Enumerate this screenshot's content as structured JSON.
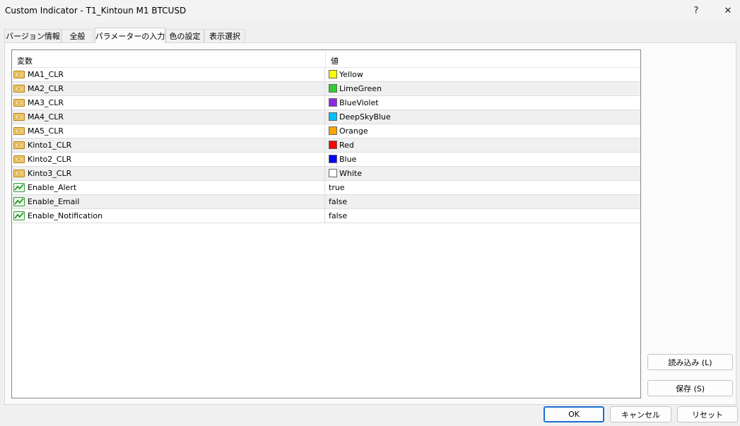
{
  "window": {
    "title": "Custom Indicator - T1_Kintoun M1 BTCUSD",
    "help_label": "?",
    "close_label": "✕"
  },
  "tabs": [
    {
      "label": "バージョン情報"
    },
    {
      "label": "全般"
    },
    {
      "label": "パラメーターの入力",
      "active": true
    },
    {
      "label": "色の設定"
    },
    {
      "label": "表示選択"
    }
  ],
  "grid": {
    "col_variable": "変数",
    "col_value": "値",
    "rows": [
      {
        "name": "MA1_CLR",
        "value": "Yellow",
        "kind": "color",
        "color": "#ffff00",
        "icon": "color-param-icon"
      },
      {
        "name": "MA2_CLR",
        "value": "LimeGreen",
        "kind": "color",
        "color": "#32cd32",
        "icon": "color-param-icon"
      },
      {
        "name": "MA3_CLR",
        "value": "BlueViolet",
        "kind": "color",
        "color": "#8a2be2",
        "icon": "color-param-icon"
      },
      {
        "name": "MA4_CLR",
        "value": "DeepSkyBlue",
        "kind": "color",
        "color": "#00bfff",
        "icon": "color-param-icon"
      },
      {
        "name": "MA5_CLR",
        "value": "Orange",
        "kind": "color",
        "color": "#ffa500",
        "icon": "color-param-icon"
      },
      {
        "name": "Kinto1_CLR",
        "value": "Red",
        "kind": "color",
        "color": "#ff0000",
        "icon": "color-param-icon"
      },
      {
        "name": "Kinto2_CLR",
        "value": "Blue",
        "kind": "color",
        "color": "#0000ff",
        "icon": "color-param-icon"
      },
      {
        "name": "Kinto3_CLR",
        "value": "White",
        "kind": "color",
        "color": "#ffffff",
        "icon": "color-param-icon"
      },
      {
        "name": "Enable_Alert",
        "value": "true",
        "kind": "bool",
        "icon": "bool-param-icon"
      },
      {
        "name": "Enable_Email",
        "value": "false",
        "kind": "bool",
        "icon": "bool-param-icon"
      },
      {
        "name": "Enable_Notification",
        "value": "false",
        "kind": "bool",
        "icon": "bool-param-icon"
      }
    ]
  },
  "side_buttons": {
    "load_label": "読み込み (L)",
    "save_label": "保存 (S)"
  },
  "footer_buttons": {
    "ok_label": "OK",
    "cancel_label": "キャンセル",
    "reset_label": "リセット"
  }
}
